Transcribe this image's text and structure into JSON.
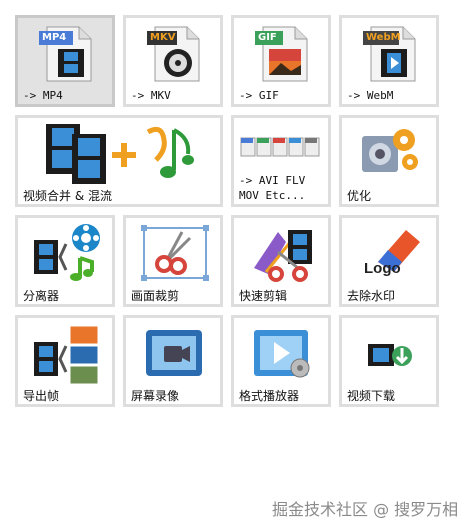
{
  "tiles": [
    {
      "id": "mp4",
      "label": "-> MP4",
      "badge": "MP4",
      "badge_color": "#4a7bd6"
    },
    {
      "id": "mkv",
      "label": "-> MKV",
      "badge": "MKV",
      "badge_color": "#333333"
    },
    {
      "id": "gif",
      "label": "-> GIF",
      "badge": "GIF",
      "badge_color": "#3aa05a"
    },
    {
      "id": "webm",
      "label": "-> WebM",
      "badge": "WebM",
      "badge_color": "#444444"
    },
    {
      "id": "merge",
      "label": "视频合并 & 混流"
    },
    {
      "id": "avi",
      "label_line1": "-> AVI FLV",
      "label_line2": "MOV Etc...",
      "mini_badges": [
        "MP4",
        "AVI",
        "MOV",
        "WMV",
        "FLV"
      ]
    },
    {
      "id": "optimize",
      "label": "优化"
    },
    {
      "id": "splitter",
      "label": "分离器"
    },
    {
      "id": "crop",
      "label": "画面裁剪"
    },
    {
      "id": "quickcut",
      "label": "快速剪辑"
    },
    {
      "id": "watermark",
      "label": "去除水印",
      "logo_text": "Logo"
    },
    {
      "id": "frames",
      "label": "导出帧"
    },
    {
      "id": "record",
      "label": "屏幕录像"
    },
    {
      "id": "player",
      "label": "格式播放器"
    },
    {
      "id": "download",
      "label": "视频下载"
    }
  ],
  "footer": {
    "watermark": "掘金技术社区 @ 搜罗万相"
  },
  "colors": {
    "tile_border": "#dedede",
    "selected_bg": "#e2e2e2",
    "film": "#1c1c1c",
    "film_frame": "#3b8fd6",
    "accent_orange": "#f0a020"
  }
}
